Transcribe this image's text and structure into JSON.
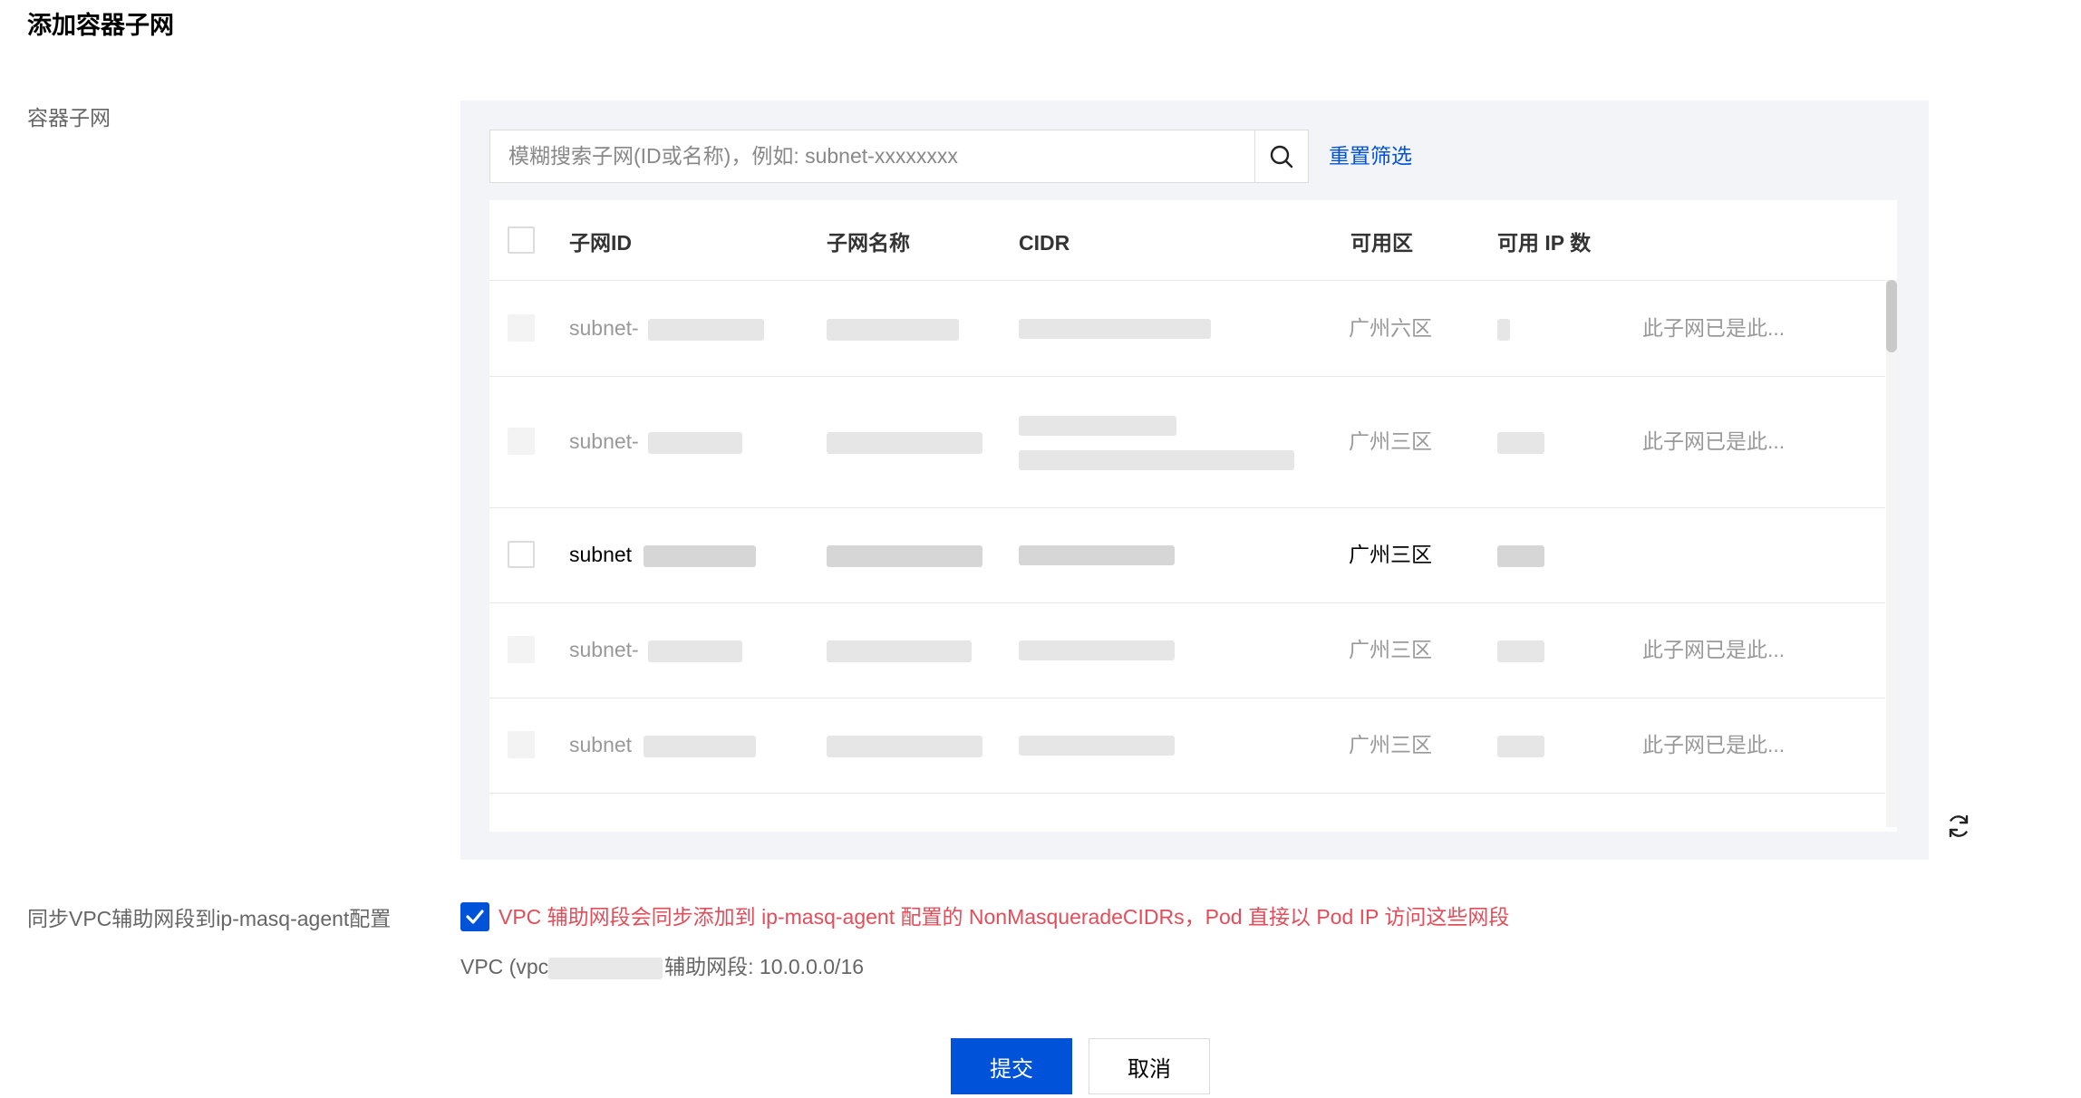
{
  "title": "添加容器子网",
  "form": {
    "subnet_label": "容器子网",
    "sync_label": "同步VPC辅助网段到ip-masq-agent配置"
  },
  "search": {
    "placeholder": "模糊搜索子网(ID或名称)，例如: subnet-xxxxxxxx",
    "value": "",
    "reset_label": "重置筛选",
    "icon": "search-icon"
  },
  "table": {
    "columns": [
      "子网ID",
      "子网名称",
      "CIDR",
      "可用区",
      "可用 IP 数"
    ],
    "rows": [
      {
        "subnet_id": "subnet-",
        "zone": "广州六区",
        "note": "此子网已是此...",
        "selectable": false
      },
      {
        "subnet_id": "subnet-",
        "zone": "广州三区",
        "note": "此子网已是此...",
        "selectable": false
      },
      {
        "subnet_id": "subnet",
        "zone": "广州三区",
        "note": "",
        "selectable": true
      },
      {
        "subnet_id": "subnet-",
        "zone": "广州三区",
        "note": "此子网已是此...",
        "selectable": false
      },
      {
        "subnet_id": "subnet",
        "zone": "广州三区",
        "note": "此子网已是此...",
        "selectable": false
      }
    ]
  },
  "refresh_icon": "refresh-icon",
  "sync": {
    "checked": true,
    "description": "VPC 辅助网段会同步添加到 ip-masq-agent 配置的 NonMasqueradeCIDRs，Pod 直接以 Pod IP 访问这些网段",
    "vpc_prefix": "VPC (vpc",
    "vpc_suffix": "辅助网段: 10.0.0.0/16"
  },
  "buttons": {
    "submit": "提交",
    "cancel": "取消"
  },
  "colors": {
    "primary": "#0052d9",
    "warning_text": "#e34d59",
    "panel_bg": "#f3f4f7"
  }
}
